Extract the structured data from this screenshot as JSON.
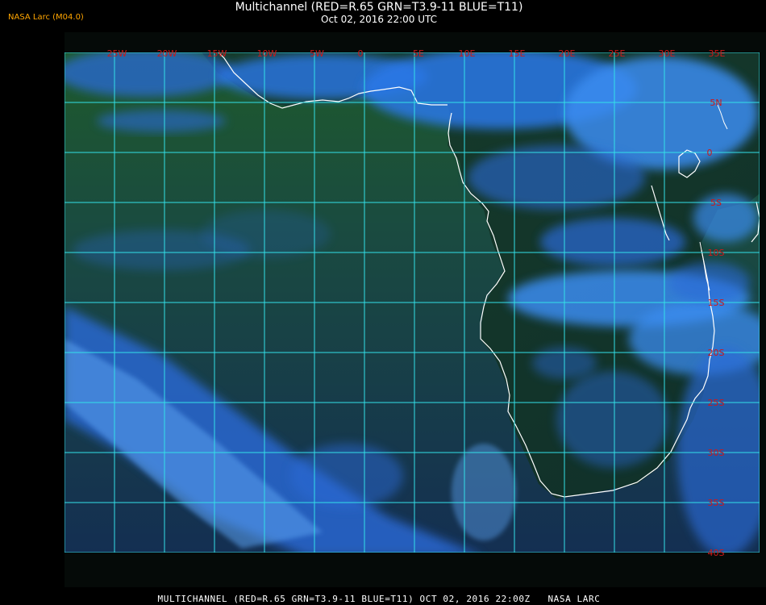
{
  "logo": "NASA Larc (M04.0)",
  "title": {
    "line1": "Multichannel (RED=R.65 GRN=T3.9-11 BLUE=T11)",
    "line2": "Oct 02, 2016 22:00 UTC"
  },
  "footer": "MULTICHANNEL (RED=R.65 GRN=T3.9-11 BLUE=T11) OCT 02, 2016 22:00Z   NASA LARC",
  "map": {
    "lon_labels": [
      "25W",
      "20W",
      "15W",
      "10W",
      "5W",
      "0",
      "5E",
      "10E",
      "15E",
      "20E",
      "25E",
      "30E",
      "35E"
    ],
    "lat_labels": [
      "5N",
      "0",
      "5S",
      "10S",
      "15S",
      "20S",
      "25S",
      "30S",
      "35S",
      "40S"
    ],
    "colors": {
      "ocean": "#1c4a2c",
      "cloud": "#2a6bd8",
      "cloud_bright": "#5aa0f0",
      "grid": "#33e0e8",
      "label": "#d01818",
      "coast": "#ffffff"
    }
  }
}
